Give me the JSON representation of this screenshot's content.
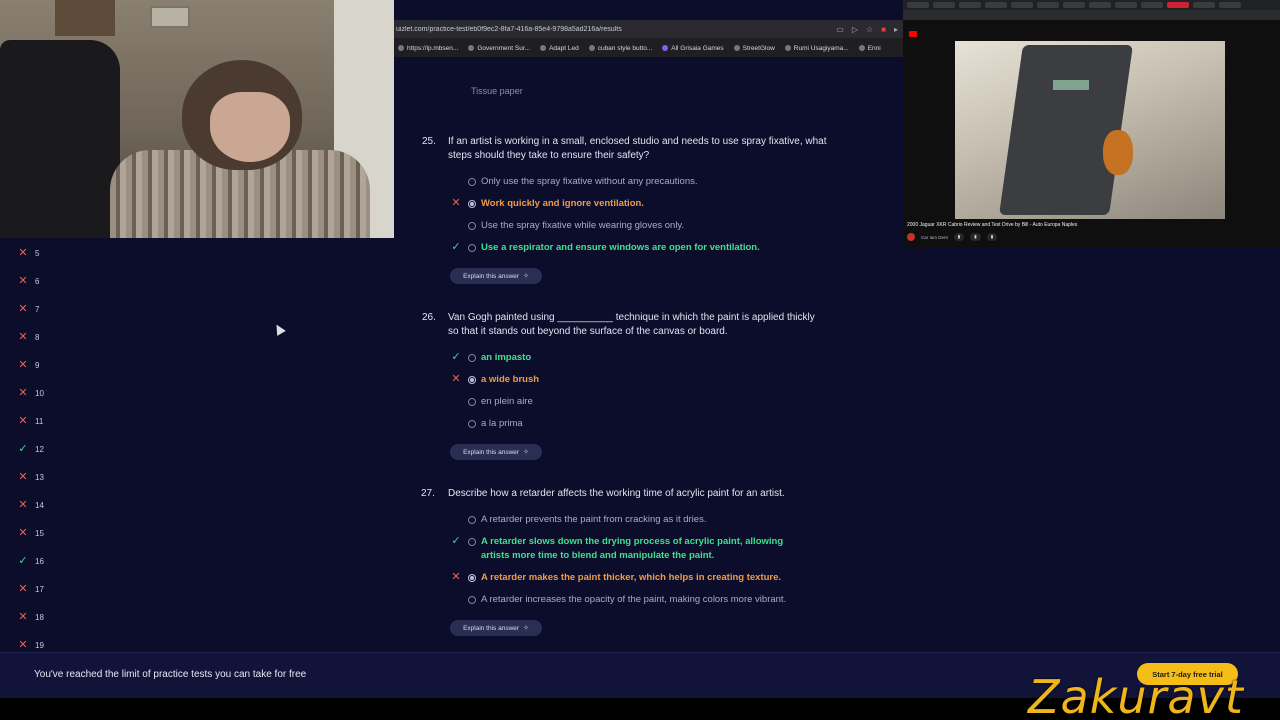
{
  "browser": {
    "url": "uizlet.com/practice-test/eb0f9ec2-8fa7-416a-85e4-9798a5ad216a/results",
    "bookmarks": [
      "https://lp.mbsen...",
      "Government Sur...",
      "Adapt Led",
      "cuban style butto...",
      "All Grisaia Games",
      "StreetGlow",
      "Rumi Usagiyama...",
      "Enni"
    ]
  },
  "nav": {
    "items": [
      {
        "number": "5",
        "status": "wrong"
      },
      {
        "number": "6",
        "status": "wrong"
      },
      {
        "number": "7",
        "status": "wrong"
      },
      {
        "number": "8",
        "status": "wrong"
      },
      {
        "number": "9",
        "status": "wrong"
      },
      {
        "number": "10",
        "status": "wrong"
      },
      {
        "number": "11",
        "status": "wrong"
      },
      {
        "number": "12",
        "status": "right"
      },
      {
        "number": "13",
        "status": "wrong"
      },
      {
        "number": "14",
        "status": "wrong"
      },
      {
        "number": "15",
        "status": "wrong"
      },
      {
        "number": "16",
        "status": "right"
      },
      {
        "number": "17",
        "status": "wrong"
      },
      {
        "number": "18",
        "status": "wrong"
      },
      {
        "number": "19",
        "status": "wrong"
      }
    ]
  },
  "questions": {
    "prev_tail": "Tissue paper",
    "q25": {
      "number": "25.",
      "text": "If an artist is working in a small, enclosed studio and needs to use spray fixative, what steps should they take to ensure their safety?",
      "options": [
        {
          "text": "Only use the spray fixative without any precautions.",
          "state": "neutral"
        },
        {
          "text": "Work quickly and ignore ventilation.",
          "state": "incorrect"
        },
        {
          "text": "Use the spray fixative while wearing gloves only.",
          "state": "neutral"
        },
        {
          "text": "Use a respirator and ensure windows are open for ventilation.",
          "state": "correct"
        }
      ]
    },
    "q26": {
      "number": "26.",
      "text": "Van Gogh painted using __________ technique in which the paint is applied thickly so that it stands out beyond the surface of the canvas or board.",
      "options": [
        {
          "text": "an impasto",
          "state": "correct"
        },
        {
          "text": "a wide brush",
          "state": "incorrect"
        },
        {
          "text": "en plein aire",
          "state": "neutral"
        },
        {
          "text": "a la prima",
          "state": "neutral"
        }
      ]
    },
    "q27": {
      "number": "27.",
      "text": "Describe how a retarder affects the working time of acrylic paint for an artist.",
      "options": [
        {
          "text": "A retarder prevents the paint from cracking as it dries.",
          "state": "neutral"
        },
        {
          "text": "A retarder slows down the drying process of acrylic paint, allowing artists more time to blend and manipulate the paint.",
          "state": "correct"
        },
        {
          "text": "A retarder makes the paint thicker, which helps in creating texture.",
          "state": "incorrect"
        },
        {
          "text": "A retarder increases the opacity of the paint, making colors more vibrant.",
          "state": "neutral"
        }
      ]
    },
    "explain_label": "Explain this answer"
  },
  "youtube": {
    "video_title": "2000 Jaguar XKR Cabrio Review and Test Drive by Bill - Auto Europa Naples",
    "channel": "Car Iam Dent"
  },
  "banner": {
    "message": "You've reached the limit of practice tests you can take for free",
    "cta": "Start 7-day free trial"
  },
  "watermark": "Zakuravt",
  "colors": {
    "background": "#0c0d2b",
    "correct": "#3fe08f",
    "incorrect": "#f09b48",
    "wrong_mark": "#f0604f",
    "cta": "#f4bd18"
  }
}
